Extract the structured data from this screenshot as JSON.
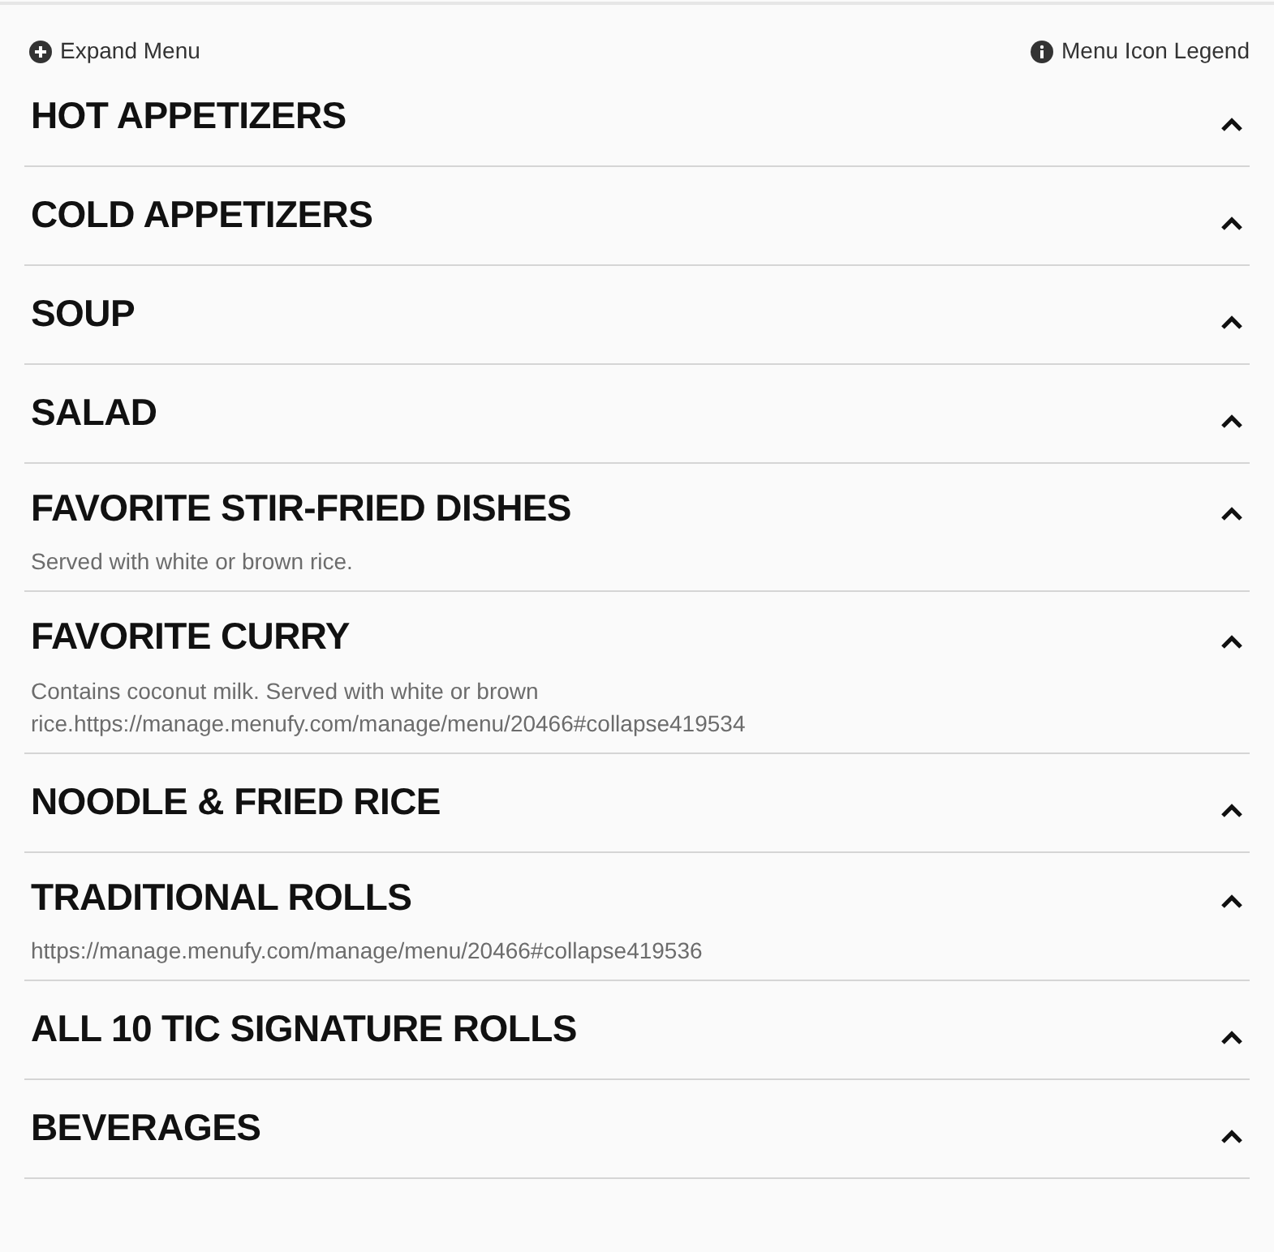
{
  "toolbar": {
    "expand": "Expand Menu",
    "legend": "Menu Icon Legend"
  },
  "categories": [
    {
      "title": "HOT APPETIZERS"
    },
    {
      "title": "COLD APPETIZERS"
    },
    {
      "title": "SOUP"
    },
    {
      "title": "SALAD"
    },
    {
      "title": "FAVORITE STIR-FRIED DISHES",
      "description": "Served with white or brown rice."
    },
    {
      "title": "FAVORITE CURRY",
      "description": "Contains coconut milk. Served with white or brown rice.https://manage.menufy.com/manage/menu/20466#collapse419534"
    },
    {
      "title": "NOODLE & FRIED RICE"
    },
    {
      "title": "TRADITIONAL ROLLS",
      "description": "https://manage.menufy.com/manage/menu/20466#collapse419536"
    },
    {
      "title": "ALL 10 TIC SIGNATURE ROLLS"
    },
    {
      "title": "BEVERAGES"
    }
  ]
}
